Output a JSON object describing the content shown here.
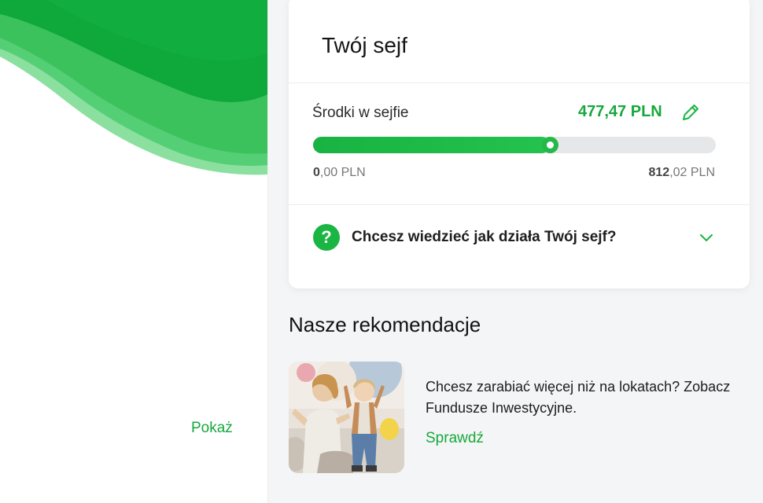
{
  "left_panel": {
    "show_link": "Pokaż",
    "accent_colors": [
      "#0fa83a",
      "#3cc25d",
      "#8be0a0"
    ]
  },
  "safe_card": {
    "title": "Twój sejf",
    "funds_label": "Środki w sejfie",
    "funds_value": "477,47 PLN",
    "edit_icon": "pencil-icon",
    "progress_fraction": 0.588,
    "min_value": {
      "main": "0",
      "rest": ",00 PLN"
    },
    "max_value": {
      "main": "812",
      "rest": ",02 PLN"
    },
    "faq": {
      "icon": "question-icon",
      "icon_glyph": "?",
      "text": "Chcesz wiedzieć jak działa Twój sejf?",
      "toggle_icon": "chevron-down-icon"
    }
  },
  "recommendations": {
    "title": "Nasze rekomendacje",
    "items": [
      {
        "text": "Chcesz zarabiać więcej niż na lokatach? Zobacz Fundusze Inwestycyjne.",
        "link": "Sprawdź"
      }
    ]
  },
  "colors": {
    "brand_green": "#16a83c",
    "track": "#e6e7e8",
    "background": "#f4f5f6"
  }
}
